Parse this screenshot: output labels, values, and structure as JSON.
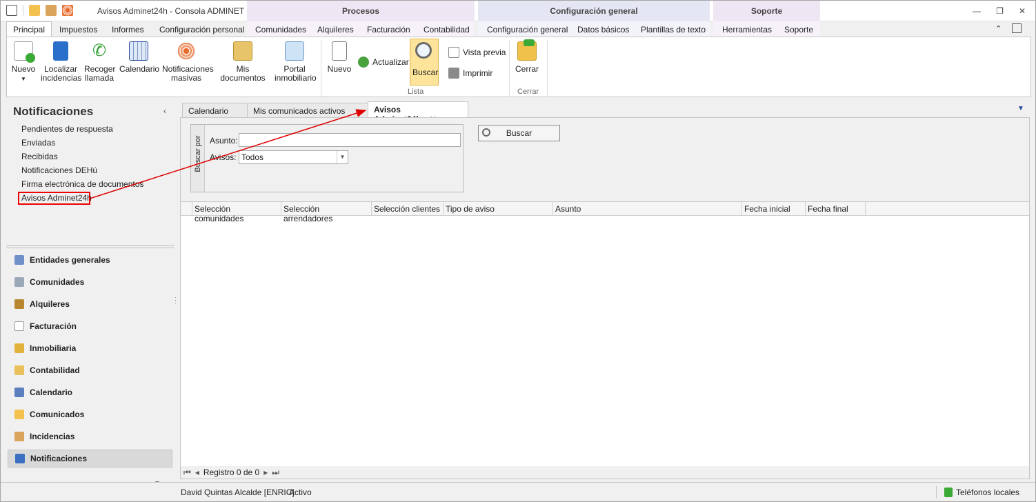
{
  "title": {
    "app_title": "Avisos Adminet24h - Consola ADMINET"
  },
  "contexts": {
    "procesos": "Procesos",
    "configuracion": "Configuración general",
    "soporte": "Soporte"
  },
  "ribbon_tabs": [
    "Principal",
    "Impuestos",
    "Informes",
    "Configuración personal",
    "Comunidades",
    "Alquileres",
    "Facturación",
    "Contabilidad",
    "Configuración general",
    "Datos básicos",
    "Plantillas de texto",
    "Herramientas",
    "Soporte"
  ],
  "ribbon": {
    "nuevo": "Nuevo",
    "localizar1": "Localizar",
    "localizar2": "incidencias",
    "recoger1": "Recoger",
    "recoger2": "llamada",
    "calendario": "Calendario",
    "notif1": "Notificaciones",
    "notif2": "masivas",
    "misdocs": "Mis documentos",
    "portal1": "Portal",
    "portal2": "inmobiliario",
    "nuevo2": "Nuevo",
    "actualizar": "Actualizar",
    "buscar": "Buscar",
    "vista_previa": "Vista previa",
    "imprimir": "Imprimir",
    "lista": "Lista",
    "cerrar": "Cerrar",
    "cerrar_group": "Cerrar"
  },
  "nav": {
    "title": "Notificaciones",
    "links": [
      "Pendientes de respuesta",
      "Enviadas",
      "Recibidas",
      "Notificaciones DEHú",
      "Firma electrónica de documentos",
      "Avisos Adminet24h"
    ],
    "groups": [
      "Entidades generales",
      "Comunidades",
      "Alquileres",
      "Facturación",
      "Inmobiliaria",
      "Contabilidad",
      "Calendario",
      "Comunicados",
      "Incidencias",
      "Notificaciones"
    ]
  },
  "doc_tabs": {
    "t1": "Calendario",
    "t2": "Mis comunicados activos",
    "t3": "Avisos Adminet24h"
  },
  "search": {
    "group_label": "Buscar por",
    "asunto_label": "Asunto:",
    "asunto_value": "",
    "avisos_label": "Avisos:",
    "avisos_value": "Todos",
    "button": "Buscar"
  },
  "grid": {
    "columns": [
      "Selección comunidades",
      "Selección arrendadores",
      "Selección clientes",
      "Tipo de aviso",
      "Asunto",
      "Fecha inicial",
      "Fecha final"
    ]
  },
  "pager": {
    "text": "Registro 0 de 0"
  },
  "status": {
    "user": "David Quintas Alcalde [ENRIC]",
    "state": "Activo",
    "phones": "Teléfonos locales"
  },
  "colors": {
    "annotation_red": "#e00000",
    "buscar_highlight": "#fde49a"
  }
}
